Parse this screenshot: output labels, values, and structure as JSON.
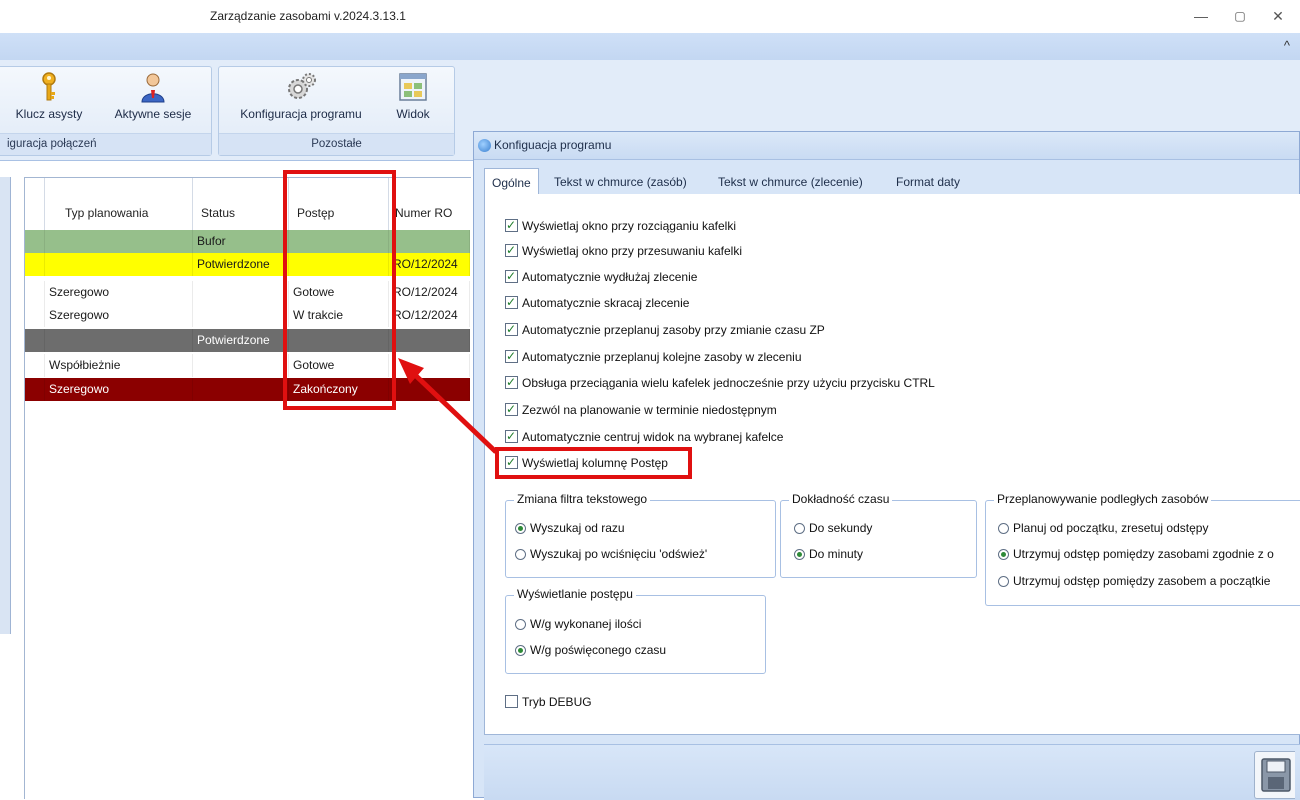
{
  "window": {
    "title": "Zarządzanie zasobami v.2024.3.13.1",
    "minimize": "—",
    "restore": "▢",
    "close": "✕"
  },
  "ribbon": {
    "collapse_glyph": "^",
    "group1": {
      "label": "iguracja połączeń",
      "buttons": [
        {
          "label": "Klucz asysty",
          "icon": "key-icon"
        },
        {
          "label": "Aktywne sesje",
          "icon": "user-icon"
        }
      ]
    },
    "group2": {
      "label": "Pozostałe",
      "buttons": [
        {
          "label": "Konfiguracja programu",
          "icon": "gears-icon"
        },
        {
          "label": "Widok",
          "icon": "view-grid-icon"
        }
      ]
    }
  },
  "grid": {
    "columns": [
      "Typ planowania",
      "Status",
      "Postęp",
      "Numer RO"
    ],
    "rows": [
      {
        "typ": "",
        "status": "Bufor",
        "postep": "",
        "numer": "",
        "bg": "#96bf8b",
        "fg": "#1a1a1a"
      },
      {
        "typ": "",
        "status": "Potwierdzone",
        "postep": "",
        "numer": "RO/12/2024",
        "bg": "#ffff00",
        "fg": "#1a1a1a"
      },
      {
        "typ": "Szeregowo",
        "status": "",
        "postep": "Gotowe",
        "numer": "RO/12/2024",
        "bg": "#ffffff",
        "fg": "#1a1a1a"
      },
      {
        "typ": "Szeregowo",
        "status": "",
        "postep": "W trakcie",
        "numer": "RO/12/2024",
        "bg": "#ffffff",
        "fg": "#1a1a1a"
      },
      {
        "typ": "",
        "status": "Potwierdzone",
        "postep": "",
        "numer": "",
        "bg": "#6d6d6d",
        "fg": "#ffffff"
      },
      {
        "typ": "Współbieżnie",
        "status": "",
        "postep": "Gotowe",
        "numer": "",
        "bg": "#ffffff",
        "fg": "#1a1a1a"
      },
      {
        "typ": "Szeregowo",
        "status": "",
        "postep": "Zakończony",
        "numer": "",
        "bg": "#8b0000",
        "fg": "#ffffff"
      }
    ]
  },
  "dialog": {
    "title": "Konfiguacja programu",
    "tabs": [
      "Ogólne",
      "Tekst w chmurce (zasób)",
      "Tekst w chmurce (zlecenie)",
      "Format daty"
    ],
    "active_tab": "Ogólne",
    "checkboxes": [
      {
        "label": "Wyświetlaj okno przy rozciąganiu kafelki",
        "checked": true
      },
      {
        "label": "Wyświetlaj okno przy przesuwaniu kafelki",
        "checked": true
      },
      {
        "label": "Automatycznie wydłużaj zlecenie",
        "checked": true
      },
      {
        "label": "Automatycznie skracaj zlecenie",
        "checked": true
      },
      {
        "label": "Automatycznie przeplanuj zasoby przy zmianie czasu ZP",
        "checked": true
      },
      {
        "label": "Automatycznie przeplanuj kolejne zasoby w zleceniu",
        "checked": true
      },
      {
        "label": "Obsługa przeciągania wielu kafelek jednocześnie przy użyciu przycisku CTRL",
        "checked": true
      },
      {
        "label": "Zezwól na planowanie w terminie niedostępnym",
        "checked": true
      },
      {
        "label": "Automatycznie centruj widok na wybranej kafelce",
        "checked": true
      },
      {
        "label": "Wyświetlaj kolumnę Postęp",
        "checked": true
      }
    ],
    "group_filter": {
      "title": "Zmiana filtra tekstowego",
      "options": [
        {
          "label": "Wyszukaj od razu",
          "selected": true
        },
        {
          "label": "Wyszukaj po wciśnięciu 'odśwież'",
          "selected": false
        }
      ]
    },
    "group_time": {
      "title": "Dokładność czasu",
      "options": [
        {
          "label": "Do sekundy",
          "selected": false
        },
        {
          "label": "Do minuty",
          "selected": true
        }
      ]
    },
    "group_replan": {
      "title": "Przeplanowywanie podległych zasobów",
      "options": [
        {
          "label": "Planuj od początku, zresetuj odstępy",
          "selected": false
        },
        {
          "label": "Utrzymuj odstęp pomiędzy zasobami zgodnie z o",
          "selected": true
        },
        {
          "label": "Utrzymuj odstęp pomiędzy zasobem a początkie",
          "selected": false
        }
      ]
    },
    "group_progress": {
      "title": "Wyświetlanie postępu",
      "options": [
        {
          "label": "W/g wykonanej ilości",
          "selected": false
        },
        {
          "label": "W/g poświęconego czasu",
          "selected": true
        }
      ]
    },
    "debug": {
      "label": "Tryb DEBUG",
      "checked": false
    }
  },
  "colors": {
    "annotation": "#e01010",
    "ribbon_bg": "#e2ecf9"
  }
}
